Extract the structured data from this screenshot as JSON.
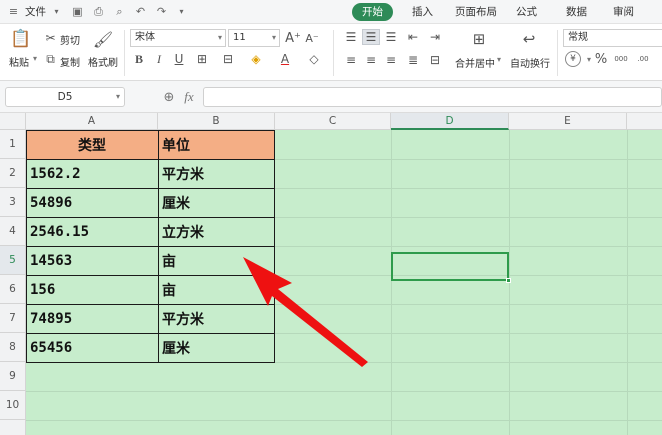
{
  "menu": {
    "file_label": "文件",
    "tabs": [
      "开始",
      "插入",
      "页面布局",
      "公式",
      "数据",
      "审阅"
    ],
    "active_tab_index": 0
  },
  "ribbon": {
    "paste_label": "粘贴",
    "cut_label": "剪切",
    "copy_label": "复制",
    "format_painter_label": "格式刷",
    "font_name": "宋体",
    "font_size": "11",
    "merge_center_label": "合并居中",
    "wrap_text_label": "自动换行",
    "number_format": "常规"
  },
  "formula_bar": {
    "name_box": "D5",
    "fx_label": "fx",
    "value": ""
  },
  "grid": {
    "columns": [
      "A",
      "B",
      "C",
      "D",
      "E"
    ],
    "selected_column": "D",
    "rows": [
      "1",
      "2",
      "3",
      "4",
      "5",
      "6",
      "7",
      "8",
      "9",
      "10"
    ],
    "selected_row": "5",
    "header": {
      "type": "类型",
      "unit": "单位"
    },
    "data": [
      {
        "type": "1562.2",
        "unit": "平方米"
      },
      {
        "type": "54896",
        "unit": "厘米"
      },
      {
        "type": "2546.15",
        "unit": "立方米"
      },
      {
        "type": "14563",
        "unit": "亩"
      },
      {
        "type": "156",
        "unit": "亩"
      },
      {
        "type": "74895",
        "unit": "平方米"
      },
      {
        "type": "65456",
        "unit": "厘米"
      }
    ],
    "selected_cell": "D5"
  },
  "colors": {
    "accent": "#2e8b57",
    "sheet_background": "#c7edcc",
    "header_fill": "#f4ae85",
    "annotation_arrow": "#ee1111"
  }
}
